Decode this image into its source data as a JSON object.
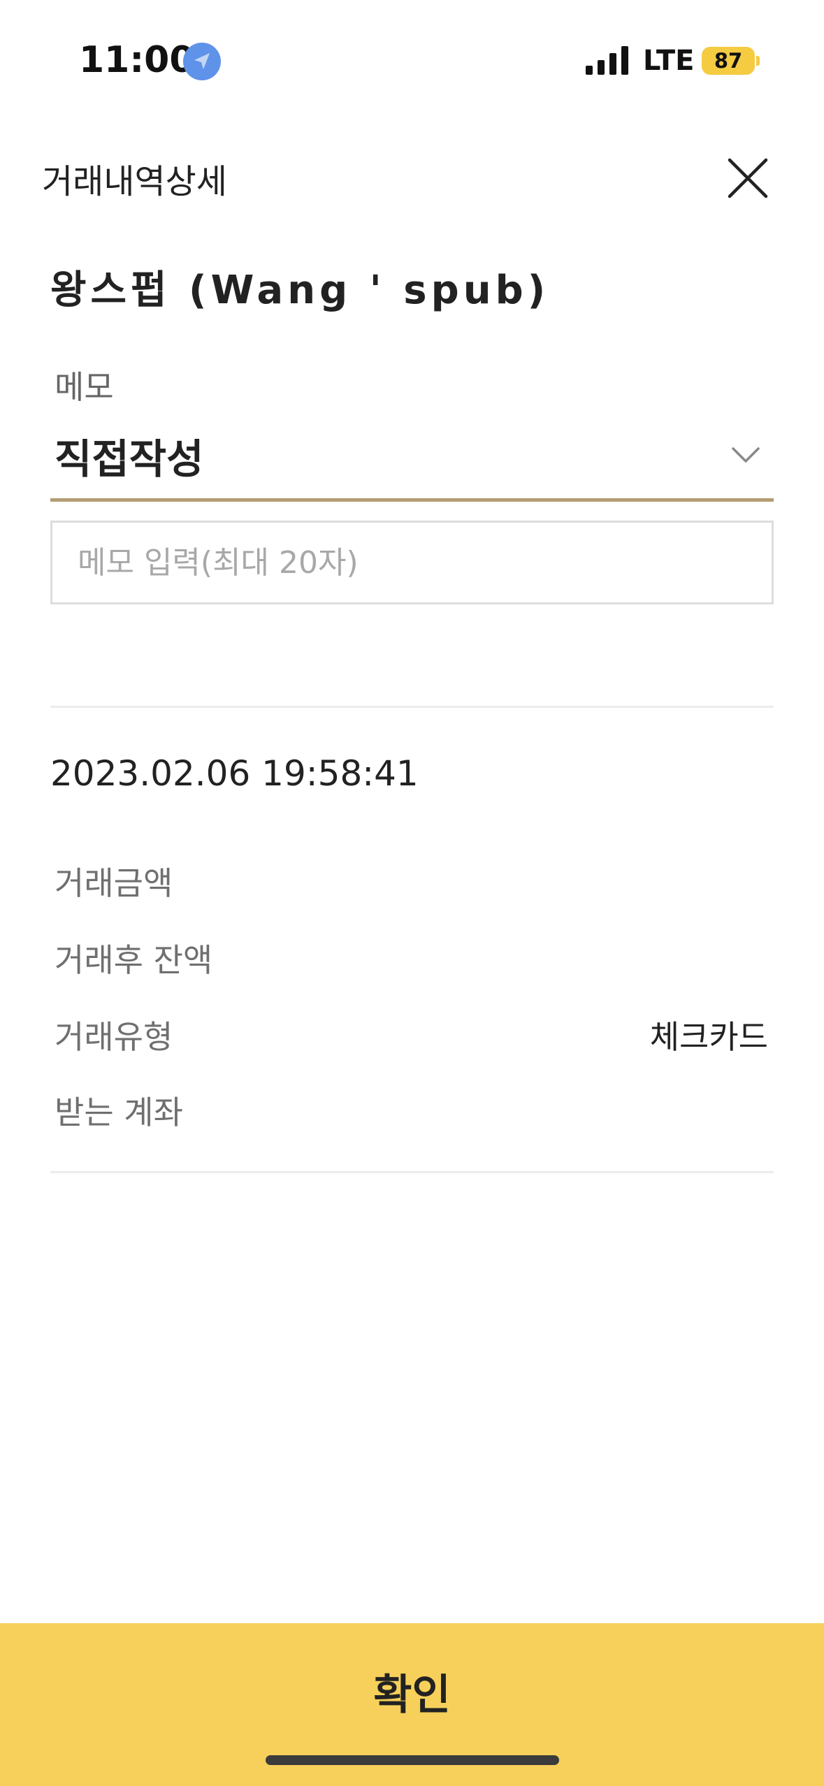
{
  "status_bar": {
    "time": "11:00",
    "network": "LTE",
    "battery": "87",
    "icons": [
      "location-arrow-icon",
      "cellular-signal-icon",
      "battery-icon"
    ]
  },
  "header": {
    "title": "거래내역상세",
    "close_icon": "close-icon"
  },
  "merchant": {
    "name": "왕스펍 (Wang ' spub)"
  },
  "memo": {
    "label": "메모",
    "selected_option": "직접작성",
    "input_placeholder": "메모 입력(최대 20자)",
    "input_value": ""
  },
  "transaction": {
    "datetime": "2023.02.06 19:58:41",
    "rows": [
      {
        "label": "거래금액",
        "value": ""
      },
      {
        "label": "거래후 잔액",
        "value": ""
      },
      {
        "label": "거래유형",
        "value": "체크카드"
      },
      {
        "label": "받는 계좌",
        "value": ""
      }
    ]
  },
  "footer": {
    "confirm_label": "확인"
  },
  "colors": {
    "accent_button": "#f6d05a",
    "underline": "#b49d74",
    "battery": "#f5cb42",
    "location_icon": "#5f93ea"
  }
}
